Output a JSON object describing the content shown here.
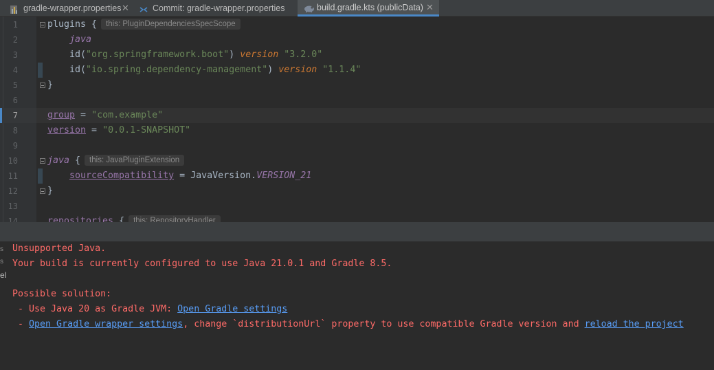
{
  "tabs": [
    {
      "label": "gradle-wrapper.properties",
      "icon": "properties-file-icon",
      "closable": true,
      "active": false
    },
    {
      "label": "Commit: gradle-wrapper.properties",
      "icon": "commit-icon",
      "closable": false,
      "active": false
    },
    {
      "label": "build.gradle.kts (publicData)",
      "icon": "gradle-kts-file-icon",
      "closable": true,
      "active": true
    }
  ],
  "editor": {
    "line_numbers": [
      "1",
      "2",
      "3",
      "4",
      "5",
      "6",
      "7",
      "8",
      "9",
      "10",
      "11",
      "12",
      "13",
      "14"
    ],
    "current_line": "7",
    "lines": {
      "l1_plugins": "plugins",
      "l1_brace": " {",
      "l1_hint": "this: PluginDependenciesSpecScope",
      "l2_java": "java",
      "l3_id": "id(",
      "l3_str": "\"org.springframework.boot\"",
      "l3_close": ") ",
      "l3_version": "version",
      "l3_ver": " \"3.2.0\"",
      "l4_id": "id(",
      "l4_str": "\"io.spring.dependency-management\"",
      "l4_close": ") ",
      "l4_version": "version",
      "l4_ver": " \"1.1.4\"",
      "l5_brace": "}",
      "l7_group": "group",
      "l7_eq": " = ",
      "l7_str": "\"com.example\"",
      "l8_version": "version",
      "l8_eq": " = ",
      "l8_str": "\"0.0.1-SNAPSHOT\"",
      "l10_java": "java",
      "l10_brace": " {",
      "l10_hint": "this: JavaPluginExtension",
      "l11_prop": "sourceCompatibility",
      "l11_eq": " = JavaVersion.",
      "l11_const": "VERSION_21",
      "l12_brace": "}",
      "l14_repos": "repositories",
      "l14_brace": " {",
      "l14_hint": "this: RepositoryHandler"
    }
  },
  "messages": {
    "line1": "Unsupported Java.",
    "line2": "Your build is currently configured to use Java 21.0.1 and Gradle 8.5.",
    "line3": "Possible solution:",
    "line4_prefix": " - Use Java 20 as Gradle JVM: ",
    "line4_link": "Open Gradle settings",
    "line5_prefix": " - ",
    "line5_link": "Open Gradle wrapper settings",
    "line5_middle": ", change `distributionUrl` property to use compatible Gradle version and ",
    "line5_link2": "reload the project"
  },
  "colors": {
    "error_text": "#ff6b68",
    "link": "#589df6",
    "string": "#6a8759",
    "keyword": "#cc7832",
    "property": "#9876aa",
    "editor_bg": "#2b2b2b"
  }
}
